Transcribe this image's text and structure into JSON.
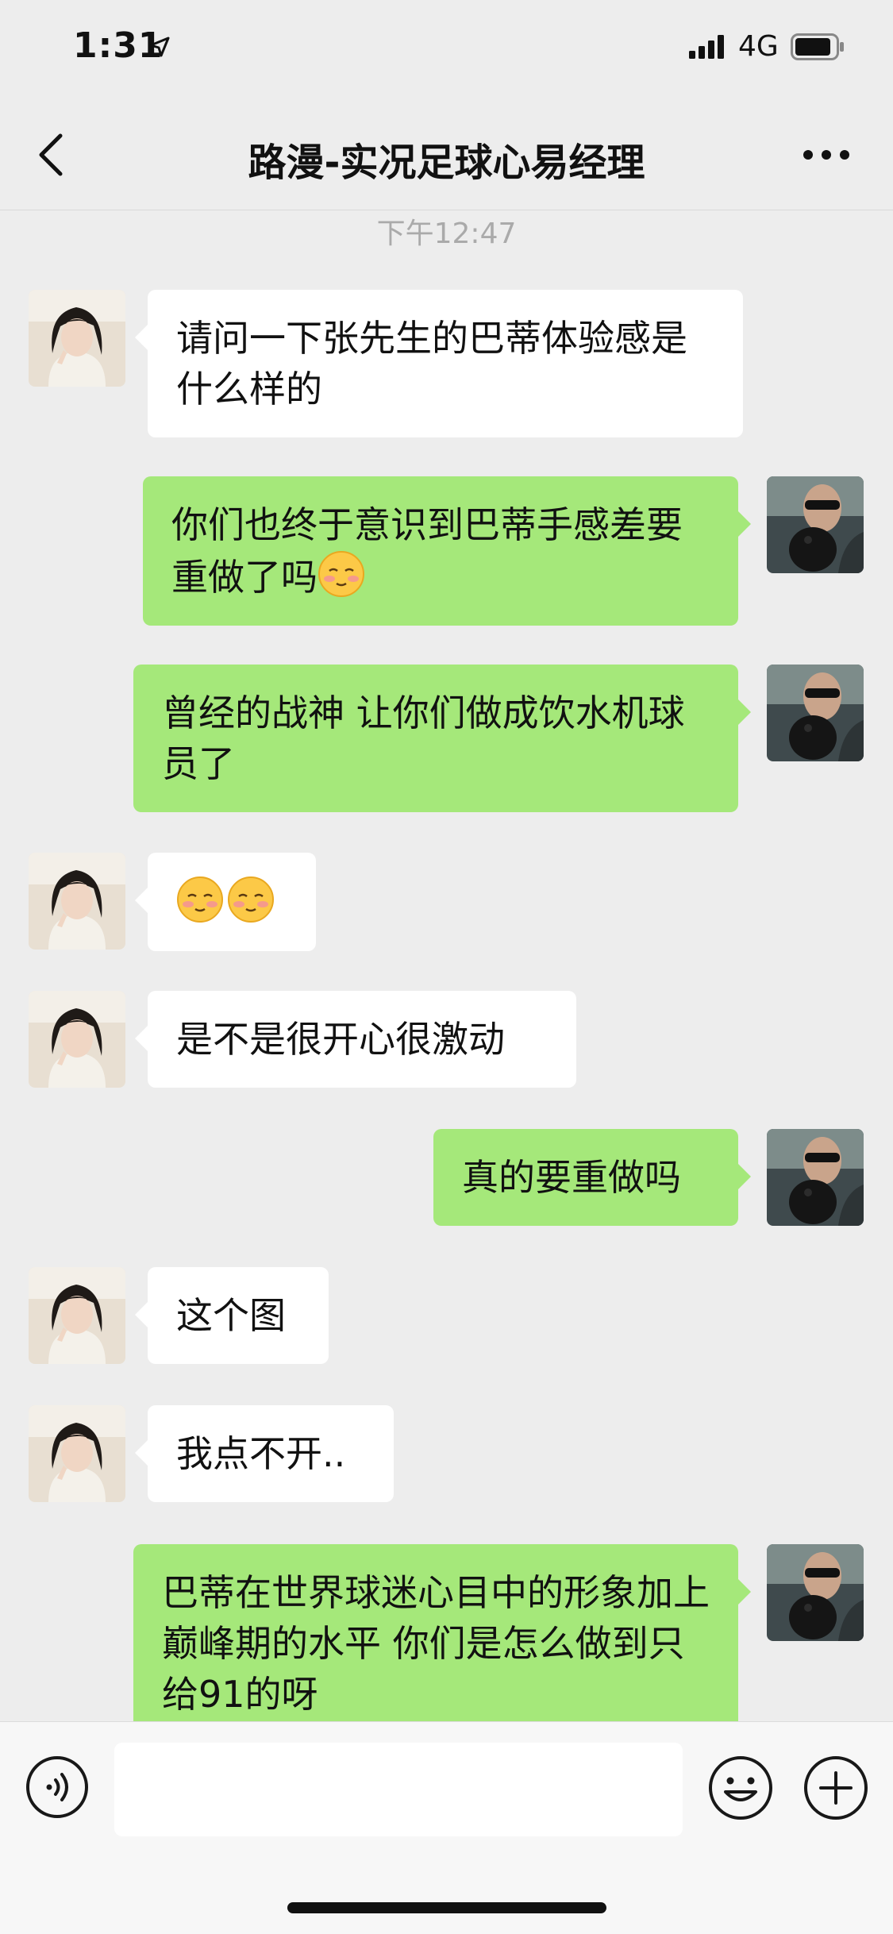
{
  "status_bar": {
    "time": "1:31",
    "network": "4G"
  },
  "nav": {
    "title": "路漫-实况足球心易经理"
  },
  "time_divider": "下午12:47",
  "messages": [
    {
      "side": "in",
      "text": "请问一下张先生的巴蒂体验感是什么样的"
    },
    {
      "side": "out",
      "text": "你们也终于意识到巴蒂手感差要重做了吗"
    },
    {
      "side": "out",
      "text": "曾经的战神 让你们做成饮水机球员了"
    },
    {
      "side": "in",
      "text": ""
    },
    {
      "side": "in",
      "text": "是不是很开心很激动"
    },
    {
      "side": "out",
      "text": "真的要重做吗"
    },
    {
      "side": "in",
      "text": "这个图"
    },
    {
      "side": "in",
      "text": "我点不开.."
    },
    {
      "side": "out",
      "text": "巴蒂在世界球迷心目中的形象加上巅峰期的水平 你们是怎么做到只给91的呀"
    }
  ],
  "input": {
    "value": ""
  },
  "colors": {
    "background": "#ededed",
    "outgoing_bubble": "#a5e87a",
    "incoming_bubble": "#ffffff"
  }
}
